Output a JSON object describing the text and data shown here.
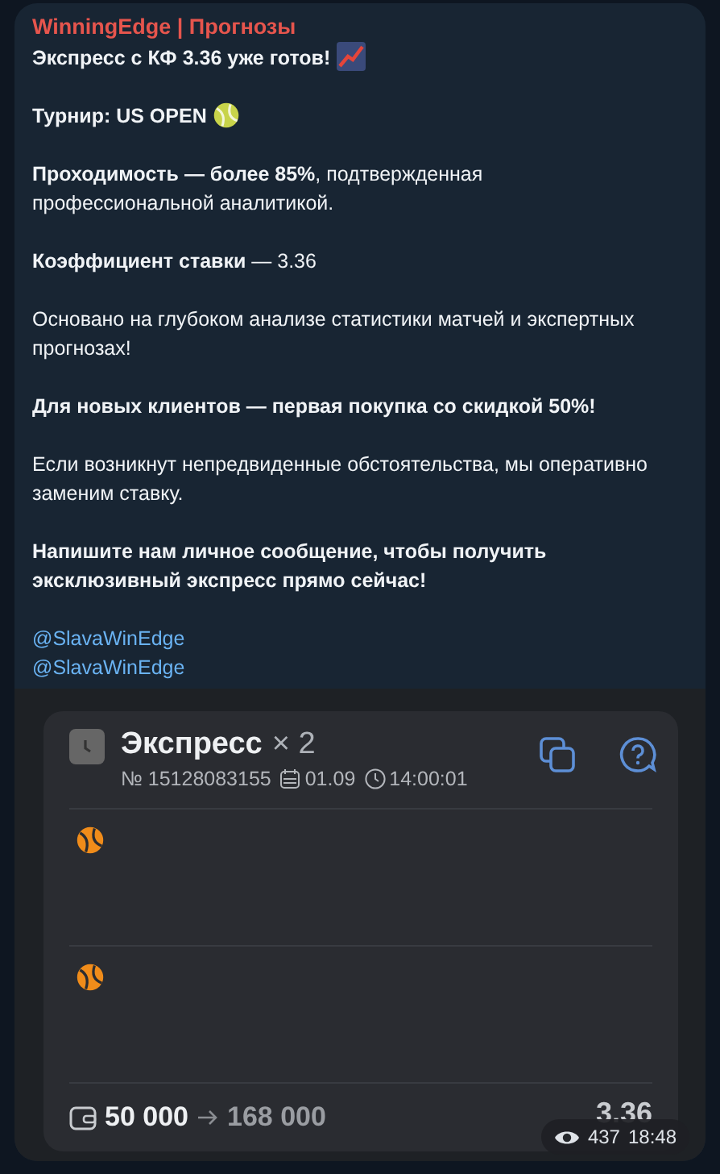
{
  "message": {
    "sender": "WinningEdge | Прогнозы",
    "paragraphs": [
      {
        "text": "Экспресс с КФ 3.36 уже готов!",
        "bold": true,
        "kind": "chart"
      },
      {
        "text": "Турнир: US OPEN",
        "bold": true,
        "kind": "tennis"
      },
      {
        "text": "**Проходимость — более 85%**, подтвержденная профессиональной аналитикой.",
        "bold": false
      },
      {
        "text": "**Коэффициент ставки** — 3.36",
        "bold": false
      },
      {
        "text": "Основано на глубоком анализе статистики матчей и экспертных прогнозах!",
        "bold": false
      },
      {
        "text": "Для новых клиентов — первая покупка со скидкой 50%!",
        "bold": true
      },
      {
        "text": "Если возникнут непредвиденные обстоятельства, мы оперативно заменим ставку.",
        "bold": false
      },
      {
        "text": "Напишите нам личное сообщение, чтобы получить эксклюзивный экспресс прямо сейчас!",
        "bold": true
      }
    ],
    "links": [
      "@SlavaWinEdge",
      "@SlavaWinEdge"
    ],
    "views": "437",
    "time": "18:48"
  },
  "bet_card": {
    "title": "Экспресс",
    "count": "× 2",
    "number": "№ 15128083155",
    "date": "01.09",
    "clock": "14:00:01",
    "events": [
      {
        "kind": "tennis"
      },
      {
        "kind": "tennis"
      }
    ],
    "stake": "50 000",
    "payout": "168 000",
    "odds": "3.36"
  }
}
